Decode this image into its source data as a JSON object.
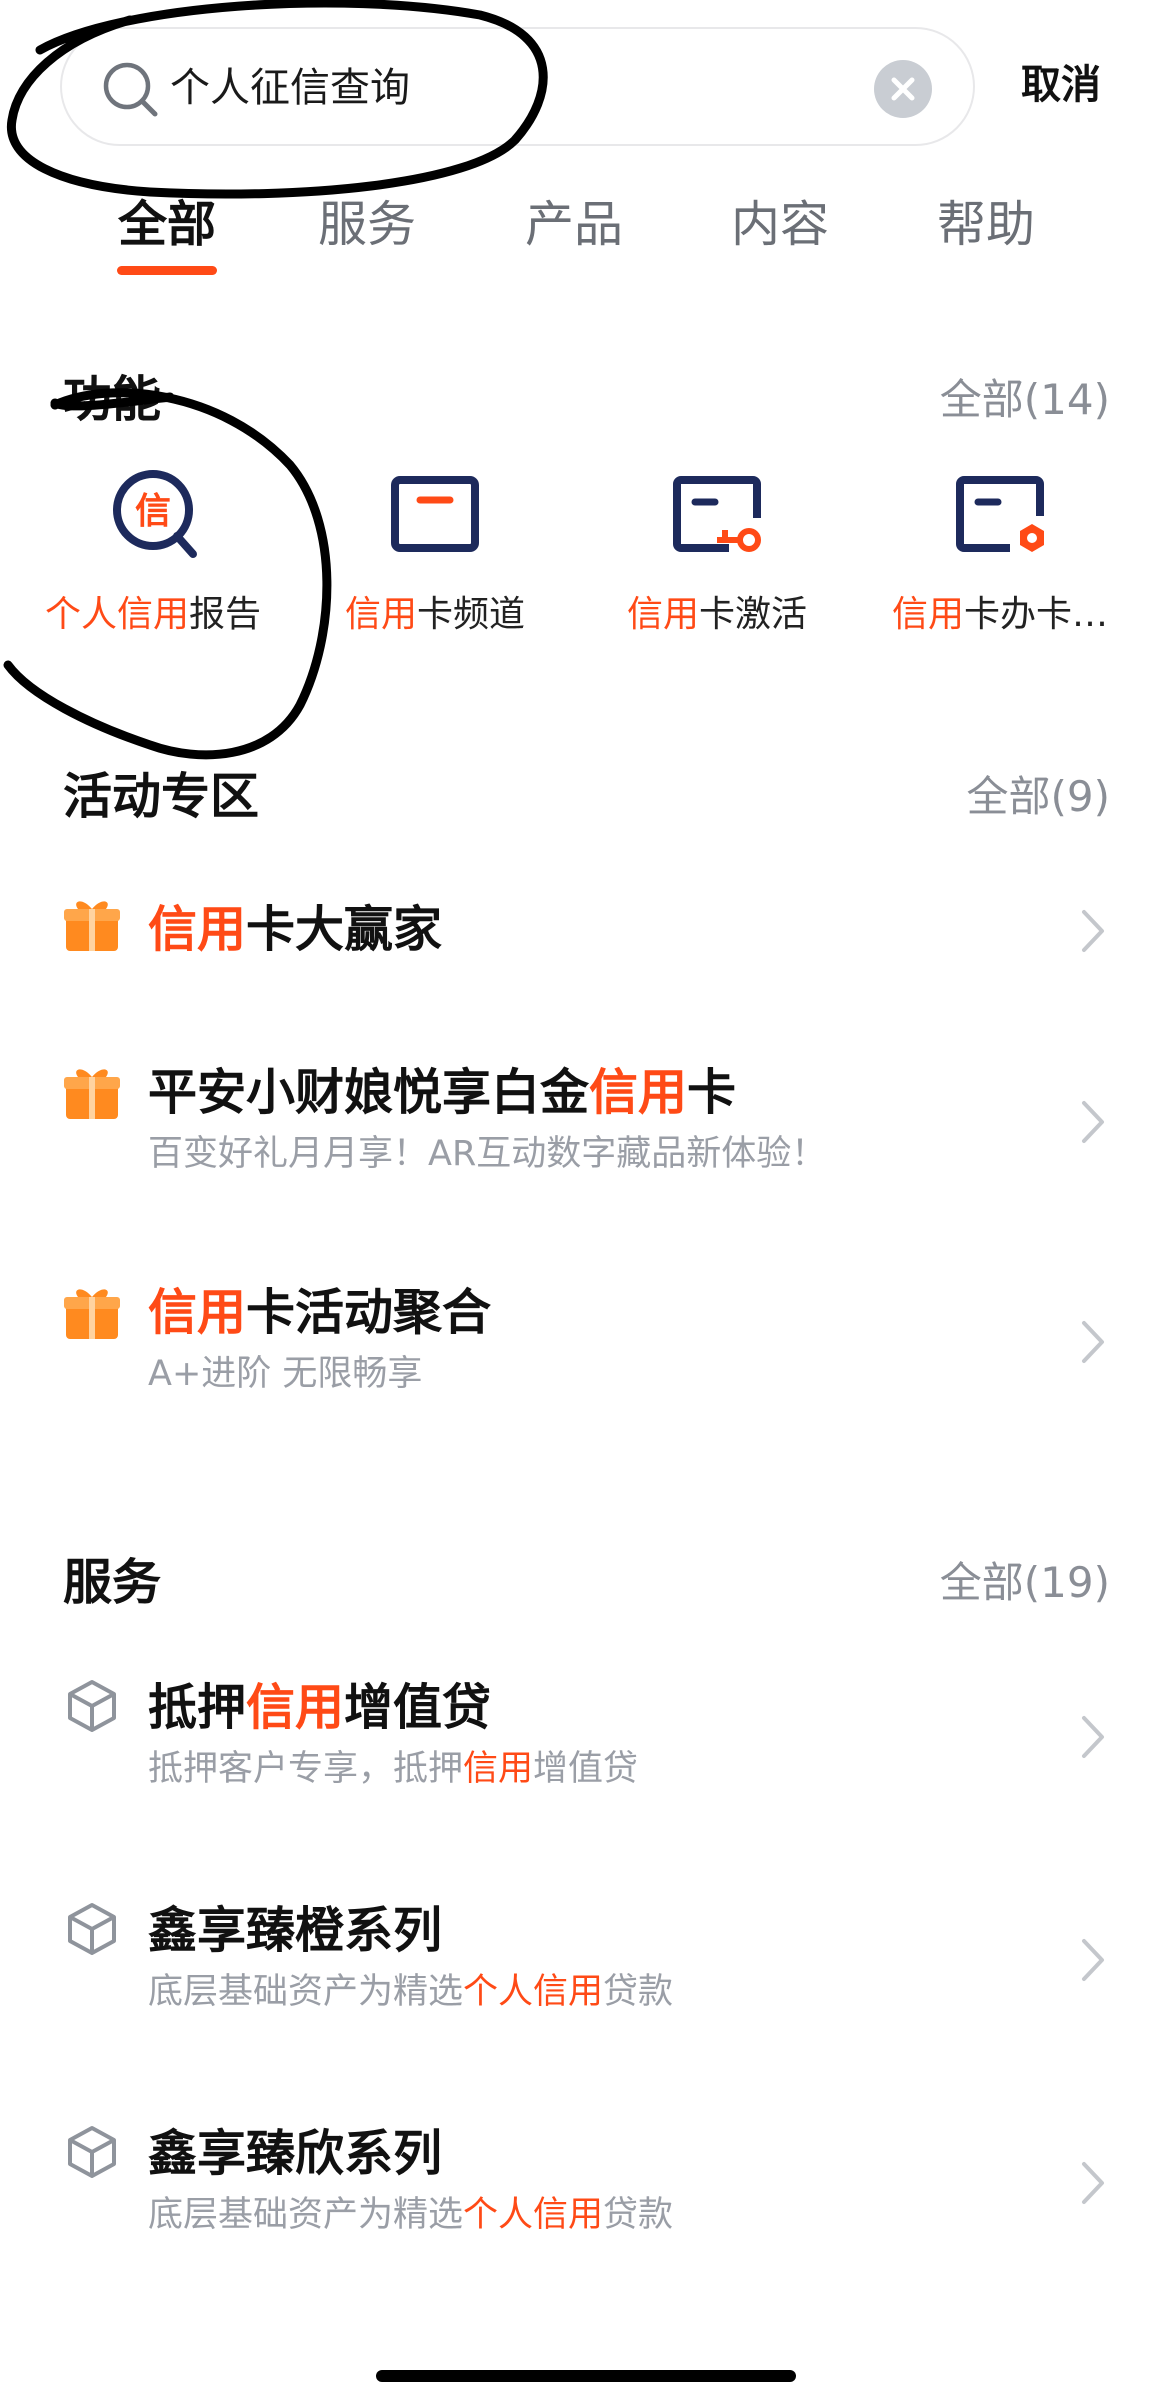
{
  "search": {
    "query": "个人征信查询",
    "cancel_label": "取消"
  },
  "tabs": [
    {
      "label": "全部",
      "active": true
    },
    {
      "label": "服务",
      "active": false
    },
    {
      "label": "产品",
      "active": false
    },
    {
      "label": "内容",
      "active": false
    },
    {
      "label": "帮助",
      "active": false
    }
  ],
  "sections": {
    "functions": {
      "title": "功能",
      "more": "全部(14)",
      "items": [
        {
          "hl": "个人信用",
          "rest": "报告",
          "icon": "credit-report-icon"
        },
        {
          "hl": "信用",
          "rest": "卡频道",
          "icon": "card-channel-icon"
        },
        {
          "hl": "信用",
          "rest": "卡激活",
          "icon": "card-activate-icon"
        },
        {
          "hl": "信用",
          "rest": "卡办卡…",
          "icon": "card-apply-icon"
        }
      ]
    },
    "activities": {
      "title": "活动专区",
      "more": "全部(9)",
      "items": [
        {
          "pre": "",
          "hl": "信用",
          "post": "卡大赢家",
          "sub_pre": "",
          "sub_hl": "",
          "sub_post": ""
        },
        {
          "pre": "平安小财娘悦享白金",
          "hl": "信用",
          "post": "卡",
          "sub_pre": "百变好礼月月享！AR互动数字藏品新体验！",
          "sub_hl": "",
          "sub_post": ""
        },
        {
          "pre": "",
          "hl": "信用",
          "post": "卡活动聚合",
          "sub_pre": "A+进阶 无限畅享",
          "sub_hl": "",
          "sub_post": ""
        }
      ]
    },
    "services": {
      "title": "服务",
      "more": "全部(19)",
      "items": [
        {
          "pre": "抵押",
          "hl": "信用",
          "post": "增值贷",
          "sub_pre": "抵押客户专享，抵押",
          "sub_hl": "信用",
          "sub_post": "增值贷"
        },
        {
          "pre": "鑫享臻橙系列",
          "hl": "",
          "post": "",
          "sub_pre": "底层基础资产为精选",
          "sub_hl": "个人信用",
          "sub_post": "贷款"
        },
        {
          "pre": "鑫享臻欣系列",
          "hl": "",
          "post": "",
          "sub_pre": "底层基础资产为精选",
          "sub_hl": "个人信用",
          "sub_post": "贷款"
        }
      ]
    }
  },
  "colors": {
    "accent": "#ff4a16",
    "icon_navy": "#1d2a5c",
    "gift_orange": "#ff8a1f",
    "muted": "#9a9ea6"
  }
}
